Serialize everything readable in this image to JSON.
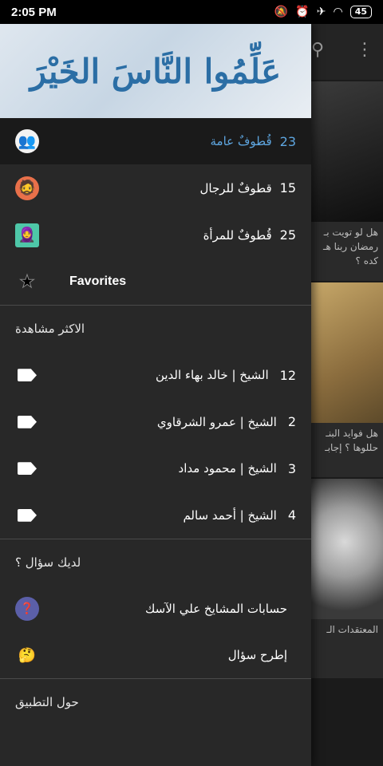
{
  "status": {
    "time": "2:05 PM",
    "battery": "45"
  },
  "drawer": {
    "banner_text": "عَلِّمُوا النَّاسَ الخَيْرَ",
    "categories": [
      {
        "label": "قُطوفٌ عامة",
        "count": "23"
      },
      {
        "label": "قطوفٌ للرجال",
        "count": "15"
      },
      {
        "label": "قُطوفٌ للمرأة",
        "count": "25"
      }
    ],
    "favorites_label": "Favorites",
    "most_viewed": {
      "title": "الاكثر مشاهدة",
      "items": [
        {
          "label": "الشيخ | خالد بهاء الدين",
          "count": "12"
        },
        {
          "label": "الشيخ | عمرو الشرقاوي",
          "count": "2"
        },
        {
          "label": "الشيخ | محمود مداد",
          "count": "3"
        },
        {
          "label": "الشيخ | أحمد سالم",
          "count": "4"
        }
      ]
    },
    "question": {
      "title": "لديك سؤال ؟",
      "items": [
        {
          "label": "حسابات المشايخ علي الآسك"
        },
        {
          "label": "إطرح سؤال"
        }
      ]
    },
    "about_title": "حول التطبيق"
  },
  "background": {
    "cards": [
      {
        "caption_1": "هل لو تويت بـ",
        "caption_2": "رمضان ربنا هـ",
        "caption_3": "كده ؟"
      },
      {
        "caption_1": "هل فوايد البنـ",
        "caption_2": "حللوها ؟ إجابـ"
      },
      {
        "caption_1": "المعتقدات الـ"
      }
    ]
  },
  "colors": {
    "accent": "#5ea6e0",
    "drawer_bg": "#282828",
    "active_bg": "#1a1a1a"
  },
  "icons": [
    "search-icon",
    "more-vert-icon",
    "star-icon",
    "tag-icon",
    "avatar-icon"
  ]
}
